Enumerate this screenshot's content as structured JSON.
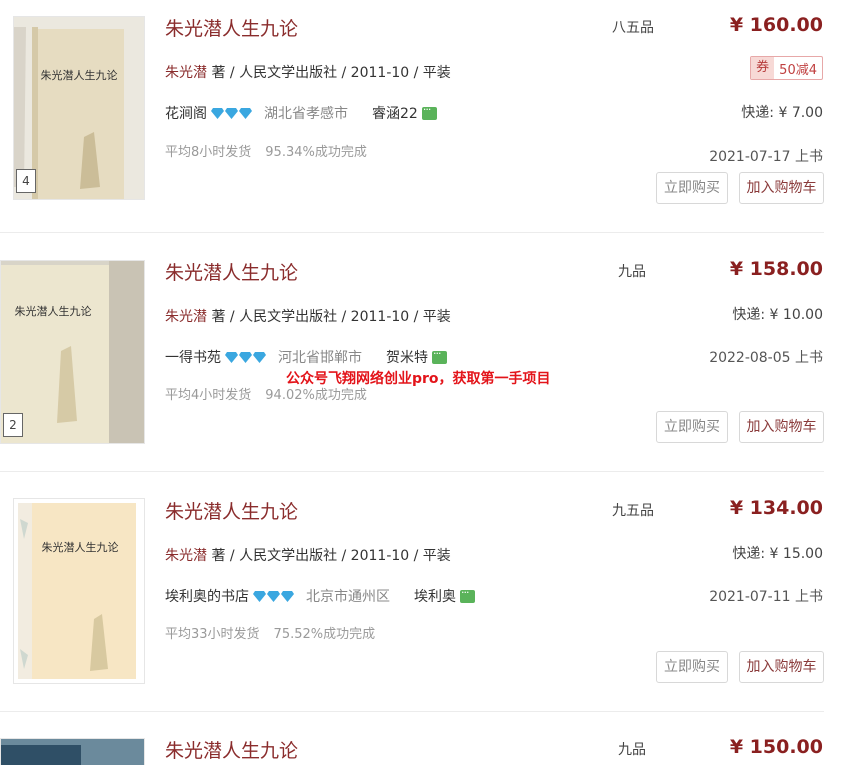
{
  "listings": [
    {
      "title": "朱光潜人生九论",
      "condition": "八五品",
      "price": "¥ 160.00",
      "author": "朱光潜",
      "meta_rest": " 著 / 人民文学出版社 / 2011-10 / 平装",
      "shop": "花涧阁",
      "location": "湖北省孝感市",
      "seller": "睿涵22",
      "avg_ship": "平均8小时发货",
      "success_rate": "95.34%成功完成",
      "shipping": "快递: ¥ 7.00",
      "date": "2021-07-17 上书",
      "coupon_tag": "券",
      "coupon_value": "50减4",
      "image_index": "4",
      "buy_label": "立即购买",
      "cart_label": "加入购物车",
      "book_cover_text": "朱光潜人生九论"
    },
    {
      "title": "朱光潜人生九论",
      "condition": "九品",
      "price": "¥ 158.00",
      "author": "朱光潜",
      "meta_rest": " 著 / 人民文学出版社 / 2011-10 / 平装",
      "shop": "一得书苑",
      "location": "河北省邯郸市",
      "seller": "贺米特",
      "avg_ship": "平均4小时发货",
      "success_rate": "94.02%成功完成",
      "shipping": "快递: ¥ 10.00",
      "date": "2022-08-05 上书",
      "image_index": "2",
      "buy_label": "立即购买",
      "cart_label": "加入购物车",
      "book_cover_text": "朱光潜人生九论"
    },
    {
      "title": "朱光潜人生九论",
      "condition": "九五品",
      "price": "¥ 134.00",
      "author": "朱光潜",
      "meta_rest": " 著 / 人民文学出版社 / 2011-10 / 平装",
      "shop": "埃利奥的书店",
      "location": "北京市通州区",
      "seller": "埃利奥",
      "avg_ship": "平均33小时发货",
      "success_rate": "75.52%成功完成",
      "shipping": "快递: ¥ 15.00",
      "date": "2021-07-11 上书",
      "buy_label": "立即购买",
      "cart_label": "加入购物车",
      "book_cover_text": "朱光潜人生九论"
    },
    {
      "title": "朱光潜人生九论",
      "condition": "九品",
      "price": "¥ 150.00"
    }
  ],
  "watermark": "公众号飞翔网络创业pro，获取第一手项目",
  "colors": {
    "title": "#8a2c2c",
    "price": "#8a2020",
    "diamond": "#3aa7e0",
    "chat": "#5ab35a",
    "watermark": "#e3141a"
  },
  "icons": {
    "diamond": "diamond-icon",
    "chat": "chat-icon"
  }
}
